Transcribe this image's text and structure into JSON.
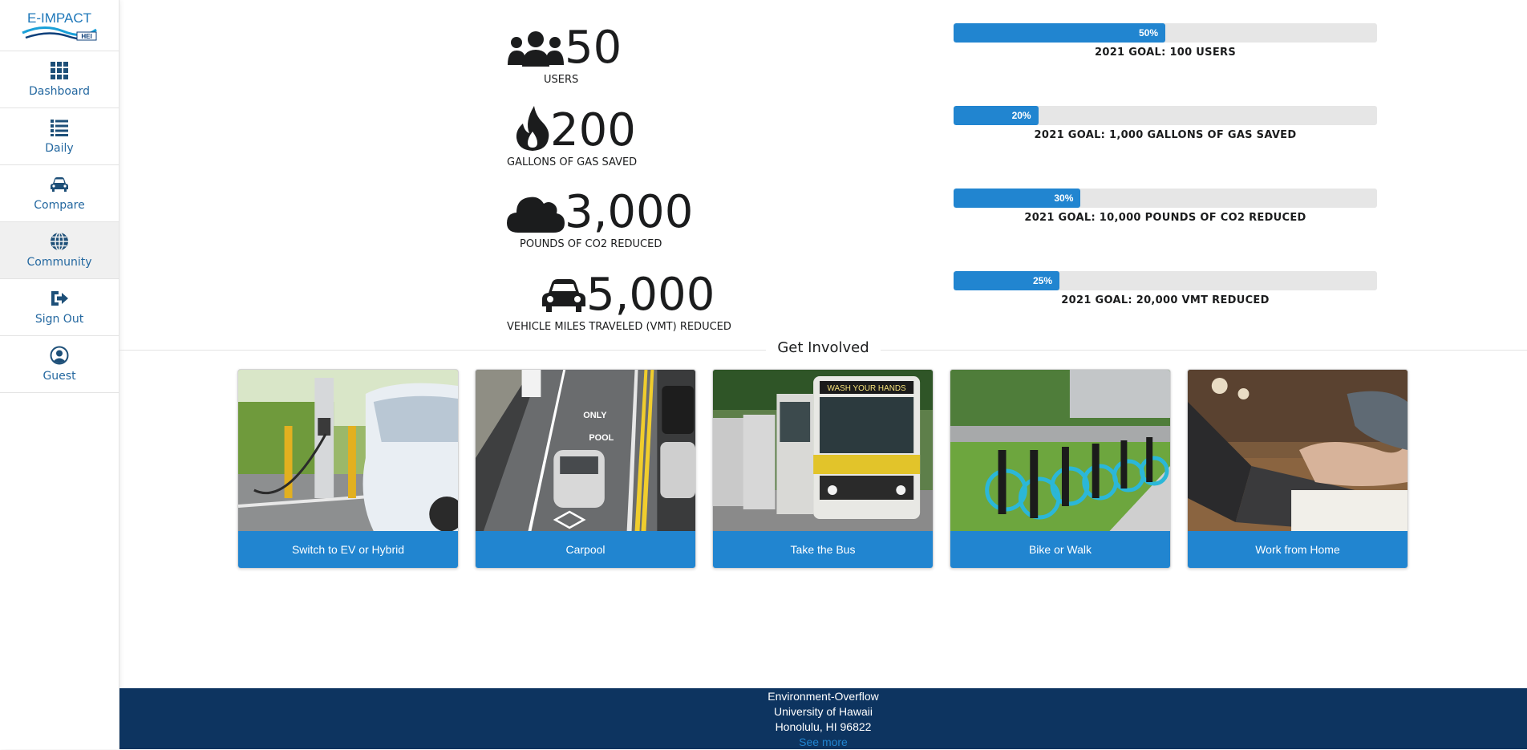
{
  "app": {
    "logo_text": "E-IMPACT",
    "logo_sub": "HEI"
  },
  "sidebar": {
    "items": [
      {
        "label": "Dashboard",
        "icon": "grid-icon"
      },
      {
        "label": "Daily",
        "icon": "list-icon"
      },
      {
        "label": "Compare",
        "icon": "car-icon"
      },
      {
        "label": "Community",
        "icon": "globe-icon",
        "active": true
      },
      {
        "label": "Sign Out",
        "icon": "sign-out-icon"
      },
      {
        "label": "Guest",
        "icon": "user-circle-icon"
      }
    ]
  },
  "stats": [
    {
      "value": "50",
      "label": "USERS",
      "icon": "users-icon"
    },
    {
      "value": "200",
      "label": "GALLONS OF GAS SAVED",
      "icon": "fire-icon"
    },
    {
      "value": "3,000",
      "label": "POUNDS OF CO2 REDUCED",
      "icon": "cloud-icon"
    },
    {
      "value": "5,000",
      "label": "VEHICLE MILES TRAVELED (VMT) REDUCED",
      "icon": "car-icon"
    }
  ],
  "goals": [
    {
      "percent": 50,
      "percent_text": "50%",
      "label": "2021 GOAL: 100 USERS"
    },
    {
      "percent": 20,
      "percent_text": "20%",
      "label": "2021 GOAL: 1,000 GALLONS OF GAS SAVED"
    },
    {
      "percent": 30,
      "percent_text": "30%",
      "label": "2021 GOAL: 10,000 POUNDS OF CO2 REDUCED"
    },
    {
      "percent": 25,
      "percent_text": "25%",
      "label": "2021 GOAL: 20,000 VMT REDUCED"
    }
  ],
  "get_involved": {
    "title": "Get Involved",
    "cards": [
      {
        "label": "Switch to EV or Hybrid"
      },
      {
        "label": "Carpool"
      },
      {
        "label": "Take the Bus"
      },
      {
        "label": "Bike or Walk"
      },
      {
        "label": "Work from Home"
      }
    ]
  },
  "footer": {
    "line1": "Environment-Overflow",
    "line2": "University of Hawaii",
    "line3": "Honolulu, HI 96822",
    "link": "See more"
  },
  "colors": {
    "accent": "#2185d0",
    "footer_bg": "#0d3460",
    "sidebar_text": "#2468a0"
  }
}
